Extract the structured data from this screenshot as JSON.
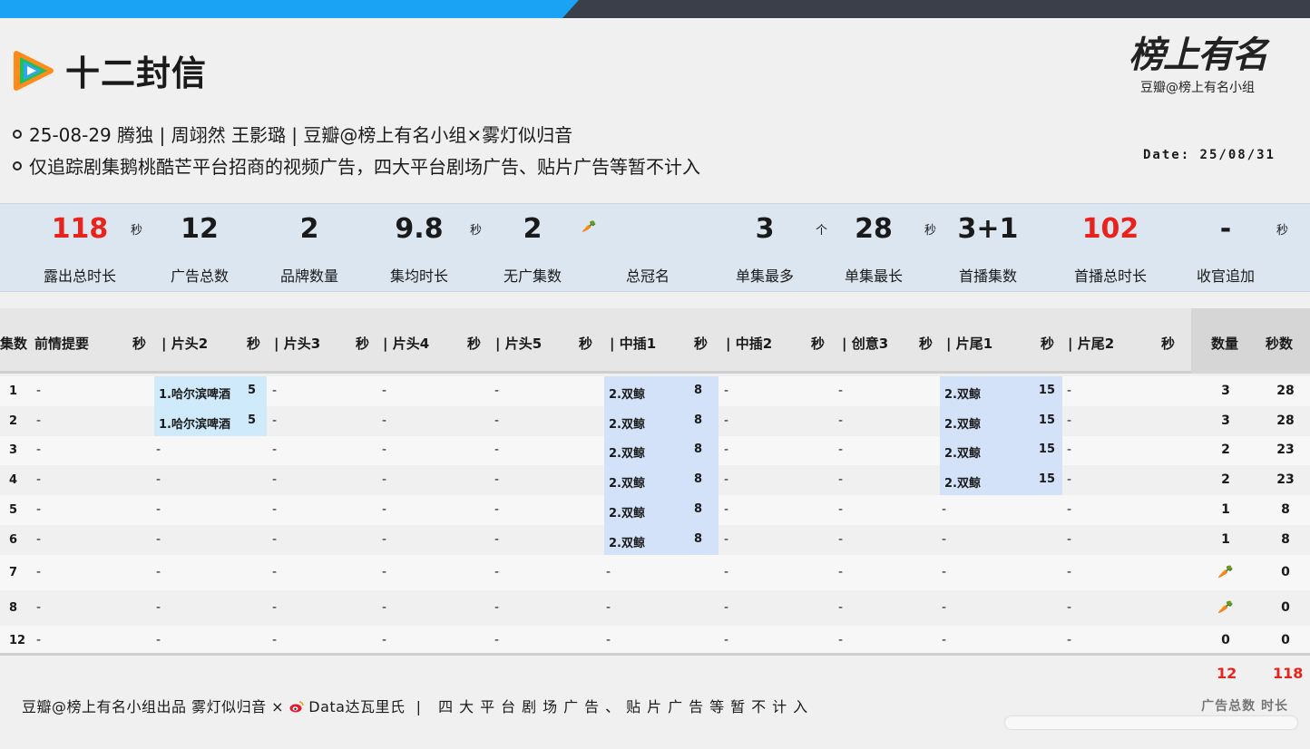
{
  "title": "十二封信",
  "logo": {
    "script": "榜上有名",
    "sub": "豆瓣@榜上有名小组"
  },
  "info_line1": "25-08-29  腾独 |  周翊然 王影璐  | 豆瓣@榜上有名小组×雾灯似归音",
  "info_line2": "仅追踪剧集鹅桃酷芒平台招商的视频广告，四大平台剧场广告、贴片广告等暂不计入",
  "date": "Date: 25/08/31",
  "stats": [
    {
      "value": "118",
      "unit": "秒",
      "label": "露出总时长",
      "red": true
    },
    {
      "value": "12",
      "unit": "",
      "label": "广告总数"
    },
    {
      "value": "2",
      "unit": "",
      "label": "品牌数量"
    },
    {
      "value": "9.8",
      "unit": "秒",
      "label": "集均时长"
    },
    {
      "value": "2",
      "unit": "🥕",
      "label": "无广集数"
    },
    {
      "value": "",
      "unit": "",
      "label": "总冠名"
    },
    {
      "value": "3",
      "unit": "个",
      "label": "单集最多"
    },
    {
      "value": "28",
      "unit": "秒",
      "label": "单集最长"
    },
    {
      "value": "3+1",
      "unit": "",
      "label": "首播集数"
    },
    {
      "value": "102",
      "unit": "",
      "label": "首播总时长",
      "red": true
    },
    {
      "value": "-",
      "unit": "秒",
      "label": "收官追加"
    }
  ],
  "headers": [
    "集数",
    "前情提要",
    "秒",
    "| 片头2",
    "秒",
    "| 片头3",
    "秒",
    "| 片头4",
    "秒",
    "| 片头5",
    "秒",
    "| 中插1",
    "秒",
    "| 中插2",
    "秒",
    "| 创意3",
    "秒",
    "| 片尾1",
    "秒",
    "| 片尾2",
    "秒",
    "数量",
    "秒数"
  ],
  "rows": [
    {
      "ep": "1",
      "c": [
        "-",
        "1.哈尔滨啤酒|5",
        "-",
        "-",
        "-",
        "2.双鲸|8",
        "-",
        "-",
        "2.双鲸|15",
        "-"
      ],
      "count": "3",
      "secs": "28"
    },
    {
      "ep": "2",
      "c": [
        "-",
        "1.哈尔滨啤酒|5",
        "-",
        "-",
        "-",
        "2.双鲸|8",
        "-",
        "-",
        "2.双鲸|15",
        "-"
      ],
      "count": "3",
      "secs": "28"
    },
    {
      "ep": "3",
      "c": [
        "-",
        "-",
        "-",
        "-",
        "-",
        "2.双鲸|8",
        "-",
        "-",
        "2.双鲸|15",
        "-"
      ],
      "count": "2",
      "secs": "23"
    },
    {
      "ep": "4",
      "c": [
        "-",
        "-",
        "-",
        "-",
        "-",
        "2.双鲸|8",
        "-",
        "-",
        "2.双鲸|15",
        "-"
      ],
      "count": "2",
      "secs": "23"
    },
    {
      "ep": "5",
      "c": [
        "-",
        "-",
        "-",
        "-",
        "-",
        "2.双鲸|8",
        "-",
        "-",
        "-",
        "-"
      ],
      "count": "1",
      "secs": "8"
    },
    {
      "ep": "6",
      "c": [
        "-",
        "-",
        "-",
        "-",
        "-",
        "2.双鲸|8",
        "-",
        "-",
        "-",
        "-"
      ],
      "count": "1",
      "secs": "8"
    },
    {
      "ep": "7",
      "c": [
        "-",
        "-",
        "-",
        "-",
        "-",
        "-",
        "-",
        "-",
        "-",
        "-"
      ],
      "count": "🥕",
      "secs": "0"
    },
    {
      "ep": "8",
      "c": [
        "-",
        "-",
        "-",
        "-",
        "-",
        "-",
        "-",
        "-",
        "-",
        "-"
      ],
      "count": "🥕",
      "secs": "0"
    },
    {
      "ep": "12",
      "c": [
        "-",
        "-",
        "-",
        "-",
        "-",
        "-",
        "-",
        "-",
        "-",
        "-"
      ],
      "count": "0",
      "secs": "0"
    }
  ],
  "totals": {
    "count": "12",
    "secs": "118"
  },
  "footer": {
    "left": "豆瓣@榜上有名小组出品  雾灯似归音 ×",
    "brand": "Data达瓦里氏",
    "right": " | 四大平台剧场广告、贴片广告等暂不计入"
  },
  "watermark": "广告总数 时长",
  "colors": {
    "accent_blue": "#1aa3f5",
    "red": "#e8231c",
    "highlight": "#d3e2f8",
    "highlight_cyan": "#cfeafb"
  }
}
